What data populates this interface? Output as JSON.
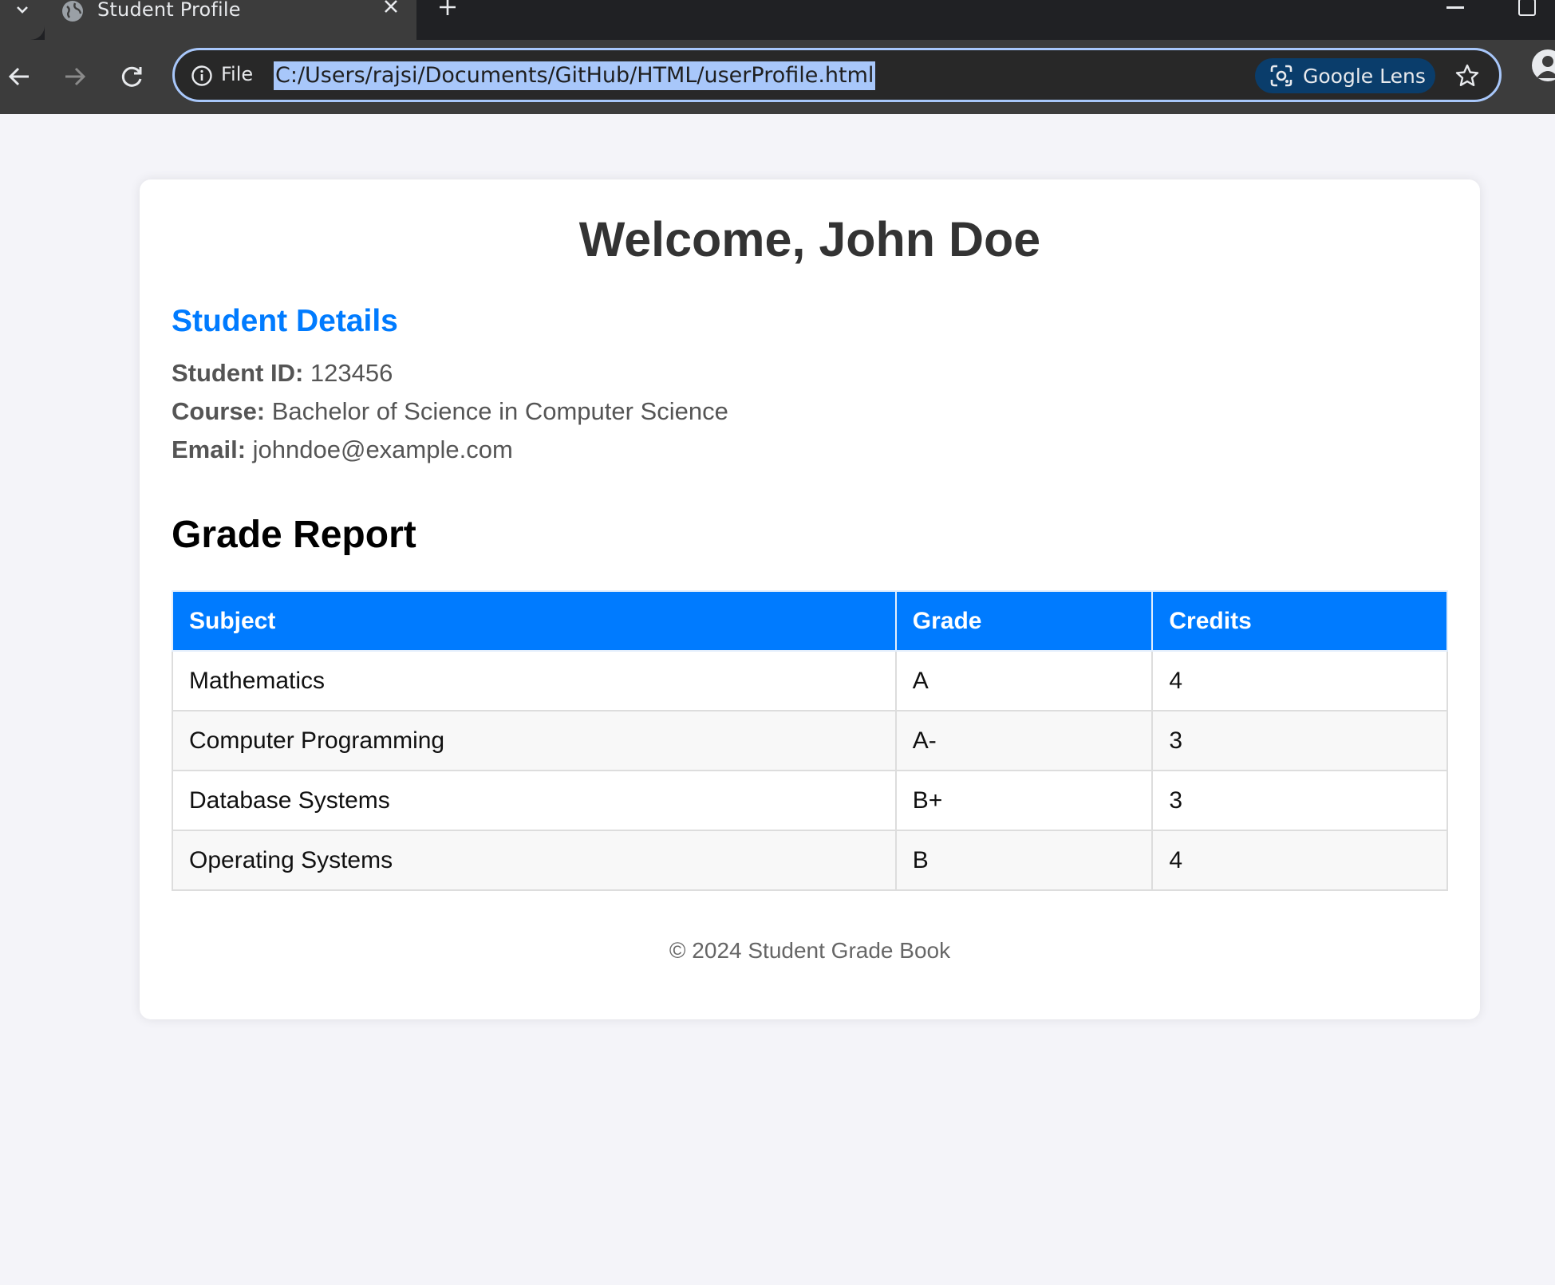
{
  "browser": {
    "tab_title": "Student Profile",
    "scheme_label": "File",
    "url": "C:/Users/rajsi/Documents/GitHub/HTML/userProfile.html",
    "lens_label": "Google Lens",
    "colors": {
      "tabbar": "#202124",
      "toolbar": "#3c3c3c",
      "omnibox_border": "#a8c7fa",
      "lens_bg": "#0a3d6b"
    }
  },
  "page": {
    "welcome": "Welcome, John Doe",
    "details_title": "Student Details",
    "details": [
      {
        "label": "Student ID:",
        "value": " 123456"
      },
      {
        "label": "Course:",
        "value": " Bachelor of Science in Computer Science"
      },
      {
        "label": "Email:",
        "value": " johndoe@example.com"
      }
    ],
    "grade_title": "Grade Report",
    "table": {
      "headers": [
        "Subject",
        "Grade",
        "Credits"
      ],
      "rows": [
        [
          "Mathematics",
          "A",
          "4"
        ],
        [
          "Computer Programming",
          "A-",
          "3"
        ],
        [
          "Database Systems",
          "B+",
          "3"
        ],
        [
          "Operating Systems",
          "B",
          "4"
        ]
      ]
    },
    "footer": "© 2024 Student Grade Book",
    "colors": {
      "accent": "#007bff",
      "background": "#f4f4f9",
      "card": "#ffffff"
    }
  }
}
